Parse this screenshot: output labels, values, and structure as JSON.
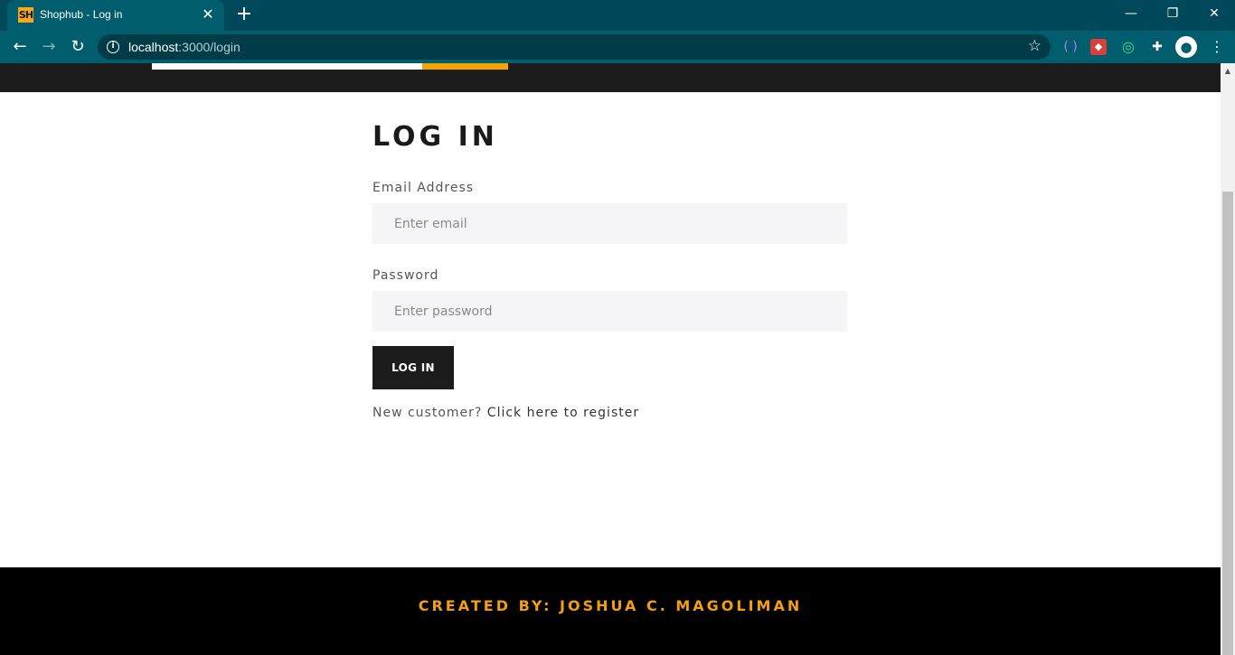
{
  "browser": {
    "tab_title": "Shophub - Log in",
    "favicon_text": "SH",
    "url_host": "localhost",
    "url_path": ":3000/login",
    "icons": [
      "back-icon",
      "forward-icon",
      "reload-icon",
      "info-icon",
      "star-icon",
      "extensions-icon",
      "profile-icon",
      "menu-icon"
    ]
  },
  "login": {
    "heading": "LOG IN",
    "email_label": "Email Address",
    "email_placeholder": "Enter email",
    "password_label": "Password",
    "password_placeholder": "Enter password",
    "submit_label": "LOG IN",
    "register_prompt": "New customer?",
    "register_link": "Click here to register"
  },
  "footer": {
    "credit": "CREATED BY: JOSHUA C. MAGOLIMAN"
  },
  "colors": {
    "chrome": "#005d6d",
    "accent": "#f4a300",
    "dark": "#1c1c1c"
  }
}
